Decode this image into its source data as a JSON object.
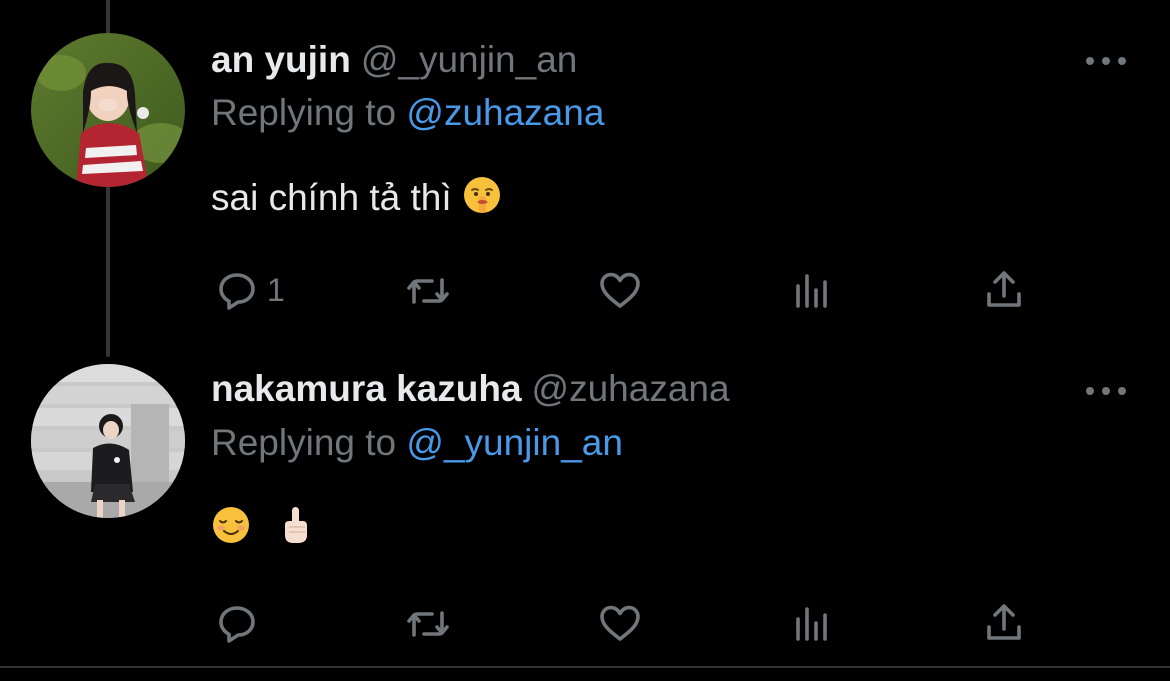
{
  "tweets": [
    {
      "display_name": "an yujin",
      "handle": "@_yunjin_an",
      "replying_prefix": "Replying to",
      "replying_to": "@zuhazana",
      "text": "sai chính tả thì",
      "emojis": [
        "shushing-face"
      ],
      "actions": {
        "reply_count": "1",
        "retweet_count": "",
        "like_count": "",
        "views_count": ""
      }
    },
    {
      "display_name": "nakamura kazuha",
      "handle": "@zuhazana",
      "replying_prefix": "Replying to",
      "replying_to": "@_yunjin_an",
      "text": "",
      "emojis": [
        "smiling-face",
        "index-pointing-up"
      ],
      "actions": {
        "reply_count": "",
        "retweet_count": "",
        "like_count": "",
        "views_count": ""
      }
    }
  ],
  "colors": {
    "background": "#000000",
    "primary_text": "#e7e9ea",
    "secondary_text": "#71767b",
    "link": "#4a99e9",
    "thread_line": "#333639"
  },
  "icons": [
    "reply-icon",
    "retweet-icon",
    "like-icon",
    "views-icon",
    "share-icon",
    "more-icon"
  ]
}
